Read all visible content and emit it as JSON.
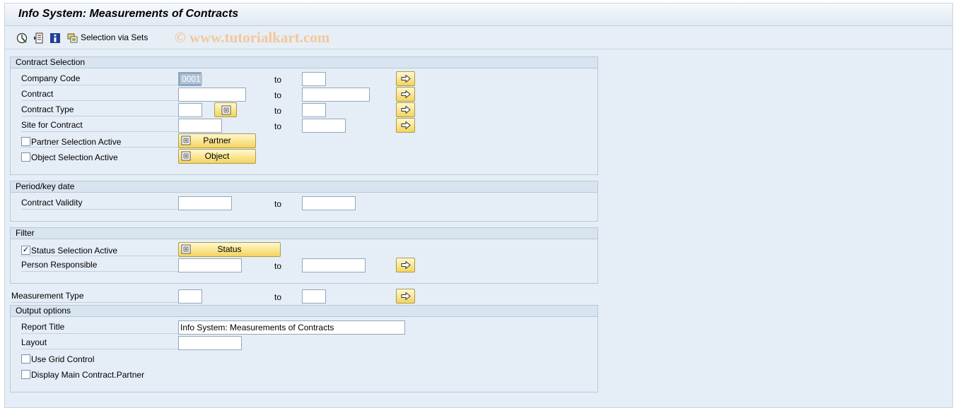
{
  "window": {
    "title": "Info System: Measurements of Contracts"
  },
  "toolbar": {
    "execute_icon": "execute-icon",
    "variants_icon": "get-variant-icon",
    "info_icon": "info-icon",
    "sets_icon": "selection-sets-icon",
    "sets_label": "Selection via Sets",
    "watermark": "© www.tutorialkart.com"
  },
  "contract_selection": {
    "header": "Contract Selection",
    "company_code": {
      "label": "Company Code",
      "from": "0001",
      "to_label": "to",
      "to": ""
    },
    "contract": {
      "label": "Contract",
      "from": "",
      "to_label": "to",
      "to": ""
    },
    "contract_type": {
      "label": "Contract Type",
      "from": "",
      "to_label": "to",
      "to": ""
    },
    "site": {
      "label": "Site for Contract",
      "from": "",
      "to_label": "to",
      "to": ""
    },
    "partner_active": {
      "label": "Partner Selection Active",
      "checked": false,
      "button": "Partner"
    },
    "object_active": {
      "label": "Object Selection Active",
      "checked": false,
      "button": "Object"
    }
  },
  "period": {
    "header": "Period/key date",
    "validity": {
      "label": "Contract Validity",
      "from": "",
      "to_label": "to",
      "to": ""
    }
  },
  "filter": {
    "header": "Filter",
    "status_active": {
      "label": "Status Selection Active",
      "checked": true,
      "check_mark": "✓",
      "button": "Status"
    },
    "person": {
      "label": "Person Responsible",
      "from": "",
      "to_label": "to",
      "to": ""
    }
  },
  "measurement": {
    "label": "Measurement Type",
    "from": "",
    "to_label": "to",
    "to": ""
  },
  "output": {
    "header": "Output options",
    "report_title": {
      "label": "Report Title",
      "value": "Info System: Measurements of Contracts"
    },
    "layout": {
      "label": "Layout",
      "value": ""
    },
    "grid": {
      "label": "Use Grid Control",
      "checked": false
    },
    "main_partner": {
      "label": "Display Main Contract.Partner",
      "checked": false
    }
  },
  "colors": {
    "button_yellow": "#f4d45d",
    "panel_bg": "#e5eef6",
    "border": "#b9c8d6"
  }
}
